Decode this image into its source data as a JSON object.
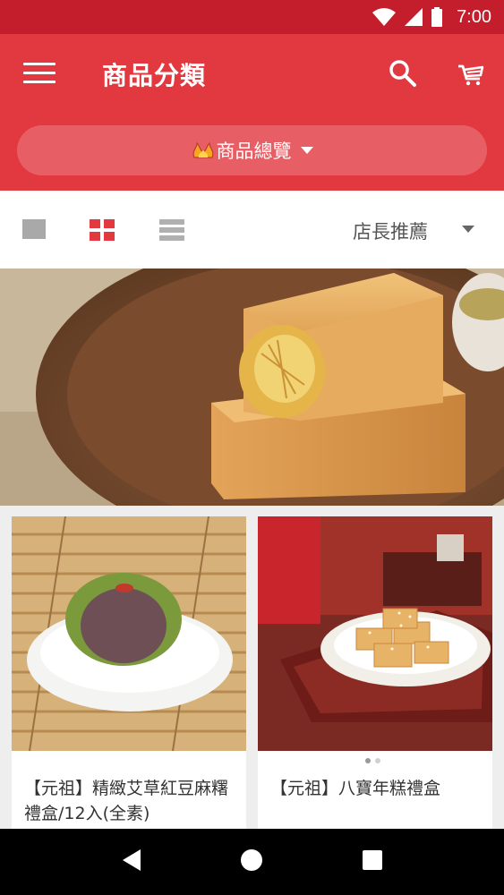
{
  "status_bar": {
    "time": "7:00"
  },
  "app_bar": {
    "title": "商品分類",
    "menu_icon": "menu-icon",
    "search_icon": "search-icon",
    "cart_icon": "cart-icon"
  },
  "category_dropdown": {
    "label": "商品總覽",
    "icon": "fire-icon"
  },
  "toolbar": {
    "sort_label": "店長推薦"
  },
  "products": [
    {
      "title": "【元祖】精緻艾草紅豆麻糬禮盒/12入(全素)"
    },
    {
      "title": "【元祖】八寶年糕禮盒"
    }
  ],
  "colors": {
    "primary": "#e2383f",
    "status_bar": "#c41d2c"
  }
}
